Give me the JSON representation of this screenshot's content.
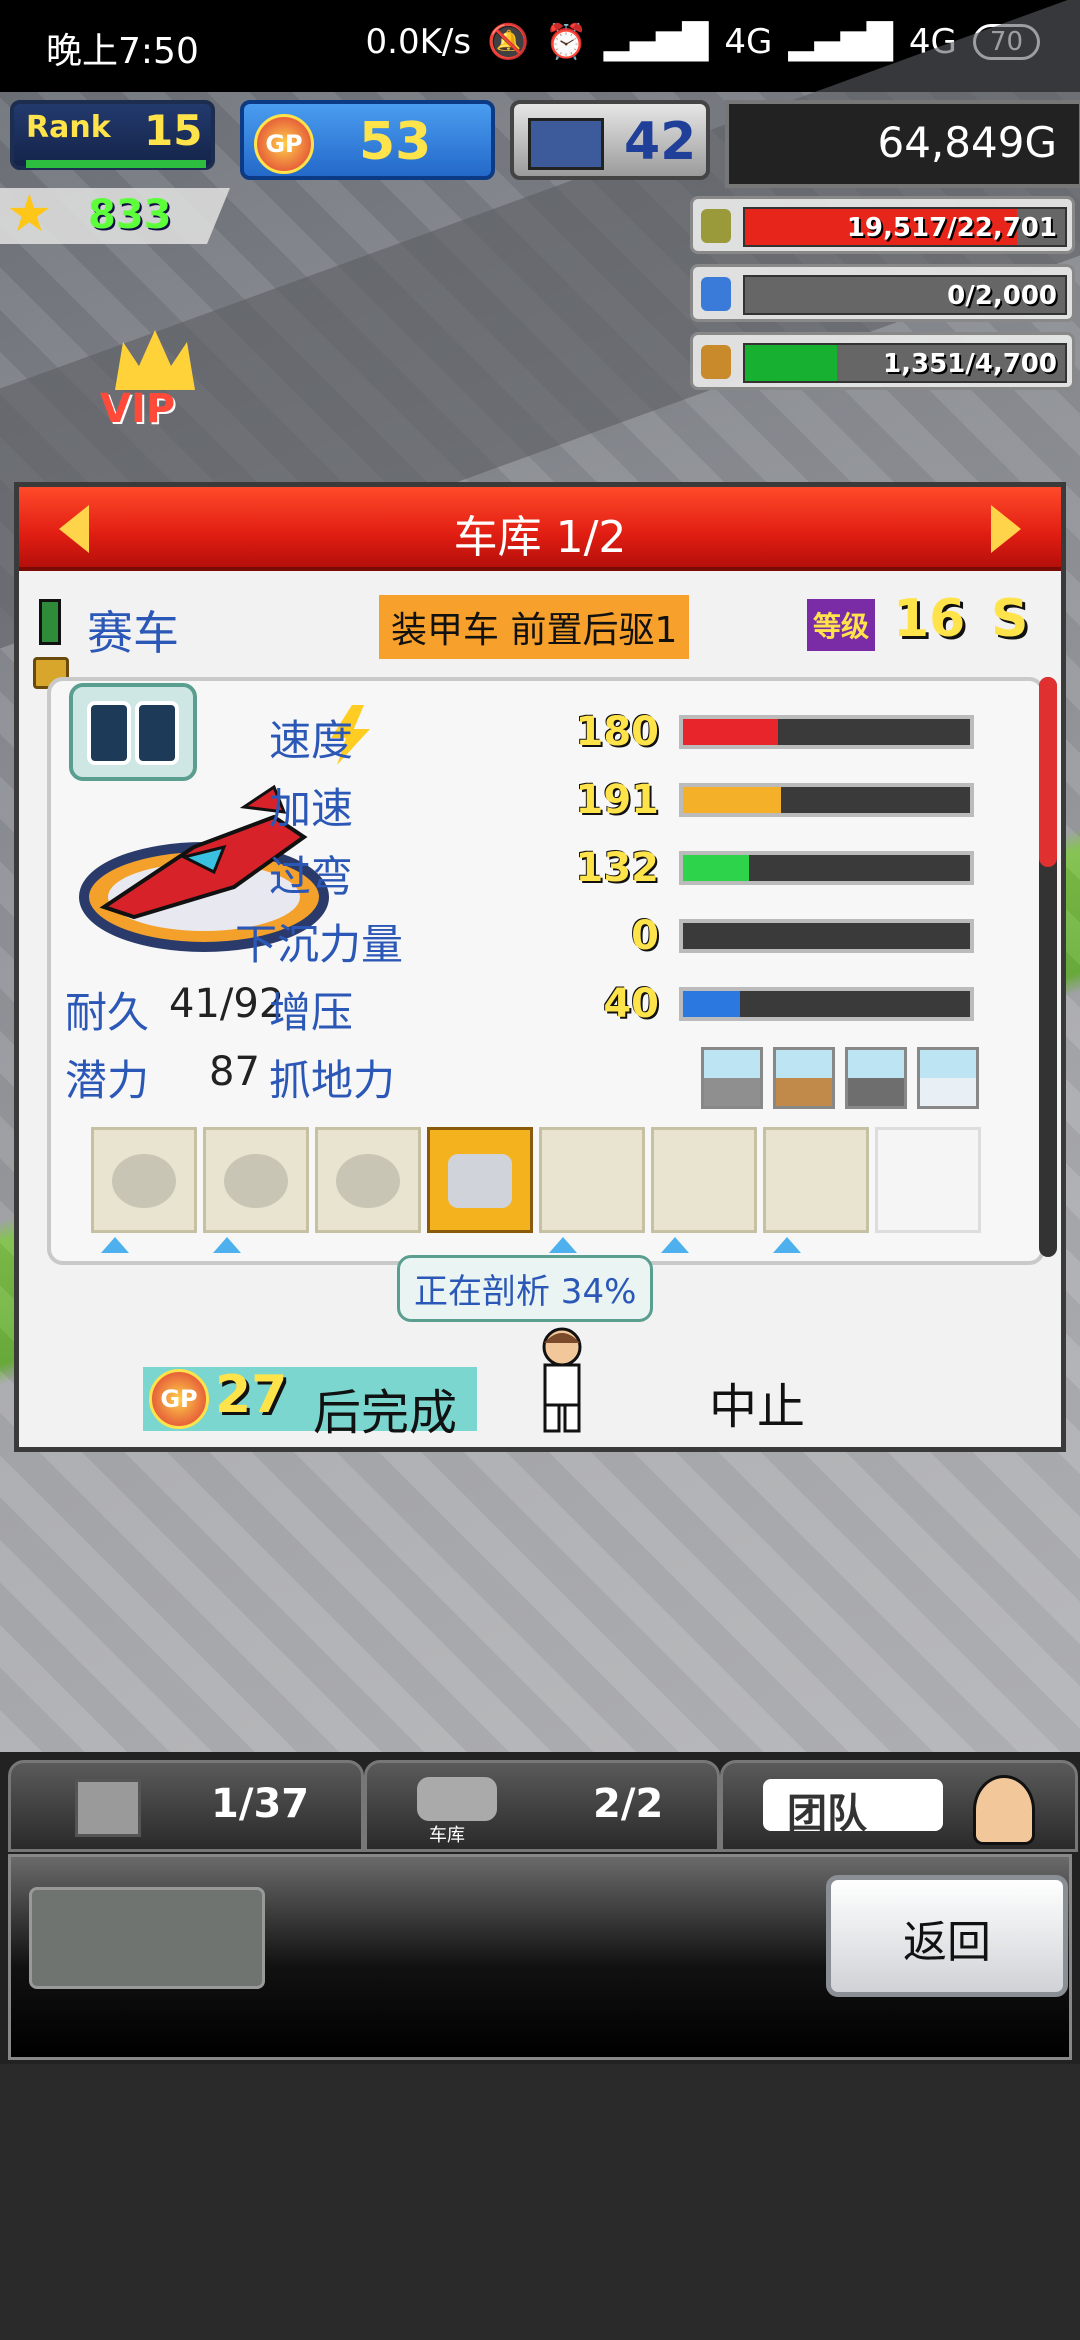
{
  "status_bar": {
    "time": "晚上7:50",
    "net_speed": "0.0K/s",
    "network1": "4G",
    "network2": "4G",
    "battery": "70"
  },
  "hud": {
    "rank_label": "Rank",
    "rank_value": "15",
    "gp_label": "GP",
    "gp_value": "53",
    "research_value": "42",
    "money": "64,849G",
    "stars": "833",
    "resources": [
      {
        "icon": "fuel-barrel-icon",
        "text": "19,517/22,701",
        "fill": 0.86,
        "color": "#e8251a"
      },
      {
        "icon": "bottle-icon",
        "text": "0/2,000",
        "fill": 0.0,
        "color": "#4a90e2"
      },
      {
        "icon": "wheat-icon",
        "text": "1,351/4,700",
        "fill": 0.29,
        "color": "#18b030"
      }
    ],
    "vip_label": "VIP"
  },
  "garage": {
    "title": "车库 1/2",
    "car_name": "赛车",
    "car_type": "装甲车 前置后驱1",
    "level_label": "等级",
    "level_value": "16",
    "grade": "S",
    "stats": [
      {
        "label": "速度",
        "value": "180",
        "fill": 0.33,
        "color": "#e8252a"
      },
      {
        "label": "加速",
        "value": "191",
        "fill": 0.34,
        "color": "#f5b02a"
      },
      {
        "label": "过弯",
        "value": "132",
        "fill": 0.23,
        "color": "#2dd34a"
      },
      {
        "label": "下沉力量",
        "value": "0",
        "fill": 0.0,
        "color": "#e8252a"
      },
      {
        "label": "增压",
        "value": "40",
        "fill": 0.2,
        "color": "#2a78e0"
      }
    ],
    "durability_label": "耐久",
    "durability_value": "41/92",
    "potential_label": "潜力",
    "potential_value": "87",
    "grip_label": "抓地力",
    "track_icons": [
      "tarmac-circle-icon",
      "dirt-cross-icon",
      "gravel-triangle-icon",
      "snow-cross-icon"
    ],
    "parts": [
      {
        "name": "engine-part-icon",
        "state": "normal"
      },
      {
        "name": "tire-part-icon",
        "state": "normal"
      },
      {
        "name": "gear-part-icon",
        "state": "normal"
      },
      {
        "name": "ecu-part-icon",
        "state": "active"
      },
      {
        "name": "empty-slot",
        "state": "normal"
      },
      {
        "name": "empty-slot",
        "state": "normal"
      },
      {
        "name": "empty-slot",
        "state": "normal"
      },
      {
        "name": "empty-slot",
        "state": "empty"
      }
    ],
    "analysis_text": "正在剖析 34%",
    "cost_gp_label": "GP",
    "cost_value": "27",
    "cost_suffix": "后完成",
    "stop_label": "中止"
  },
  "bottom_menu": {
    "tab1_count": "1/37",
    "tab2_label": "车库",
    "tab2_count": "2/2",
    "tab3_label": "团队",
    "back_label": "返回"
  }
}
